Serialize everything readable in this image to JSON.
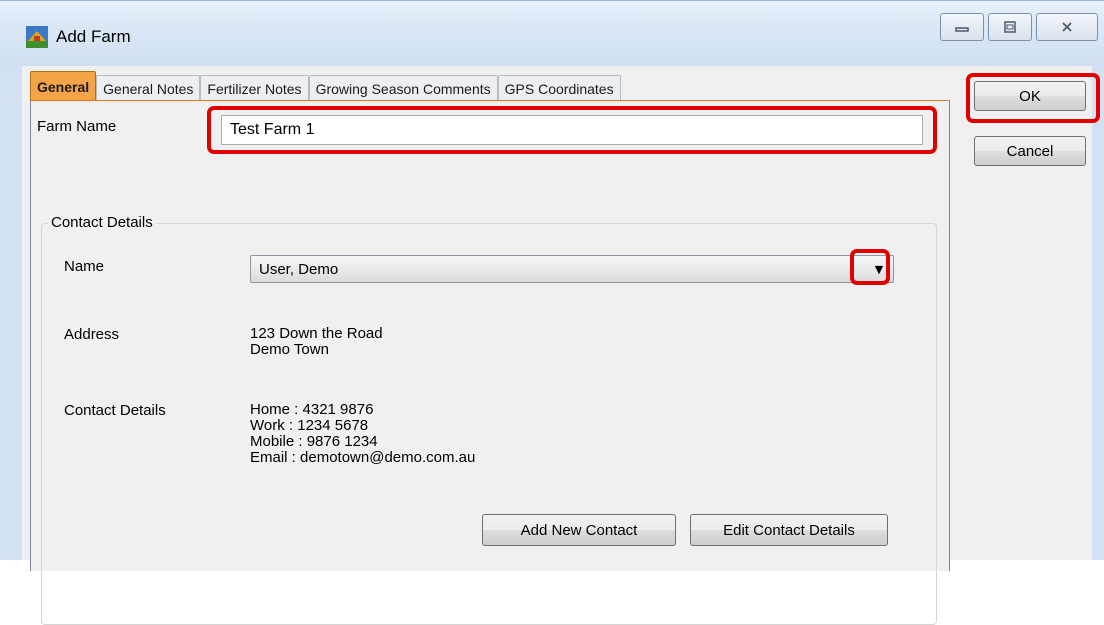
{
  "window": {
    "title": "Add Farm",
    "icon": "farm-app-icon",
    "controls": {
      "minimize": "minimize-icon",
      "maximize": "maximize-icon",
      "close": "close-icon"
    }
  },
  "tabs": [
    {
      "label": "General",
      "active": true
    },
    {
      "label": "General Notes",
      "active": false
    },
    {
      "label": "Fertilizer Notes",
      "active": false
    },
    {
      "label": "Growing Season Comments",
      "active": false
    },
    {
      "label": "GPS Coordinates",
      "active": false
    }
  ],
  "general": {
    "farm_name_label": "Farm Name",
    "farm_name_value": "Test Farm 1",
    "contact_group_title": "Contact Details",
    "name_label": "Name",
    "name_selected": "User, Demo",
    "address_label": "Address",
    "address_lines": [
      "123 Down the Road",
      "Demo Town"
    ],
    "contact_label": "Contact Details",
    "contact_lines": [
      "Home : 4321 9876",
      "Work : 1234 5678",
      "Mobile : 9876 1234",
      "Email : demotown@demo.com.au"
    ],
    "add_contact_button": "Add New Contact",
    "edit_contact_button": "Edit Contact Details"
  },
  "buttons": {
    "ok": "OK",
    "cancel": "Cancel"
  },
  "colors": {
    "highlight": "#e00000",
    "active_tab": "#f5a347",
    "title_bar": "#dbe7f6"
  }
}
